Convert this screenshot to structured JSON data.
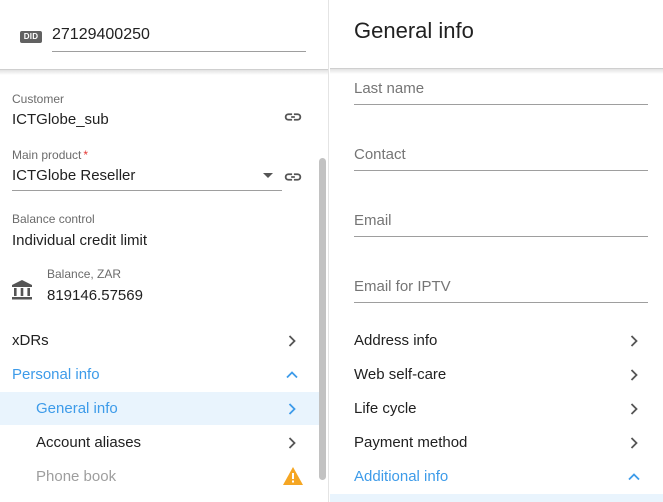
{
  "left": {
    "did": {
      "badge": "DID",
      "value": "27129400250"
    },
    "customer": {
      "label": "Customer",
      "value": "ICTGlobe_sub",
      "icon": "link-icon"
    },
    "main_product": {
      "label": "Main product",
      "required_mark": "*",
      "value": "ICTGlobe Reseller",
      "icon": "link-icon"
    },
    "balance_control": {
      "label": "Balance control",
      "value": "Individual credit limit"
    },
    "balance": {
      "label": "Balance, ZAR",
      "value": "819146.57569",
      "icon": "bank-icon"
    },
    "nav": {
      "xdrs": "xDRs",
      "personal_info": "Personal info",
      "general_info": "General info",
      "account_aliases": "Account aliases",
      "phone_book": "Phone book"
    },
    "colors": {
      "accent": "#3d9be9",
      "active_bg": "#e9f4fd",
      "warning": "#f5a623"
    }
  },
  "right": {
    "title": "General info",
    "fields": {
      "last_name": "Last name",
      "contact": "Contact",
      "email": "Email",
      "email_iptv": "Email for IPTV"
    },
    "sections": {
      "address_info": "Address info",
      "web_self_care": "Web self-care",
      "life_cycle": "Life cycle",
      "payment_method": "Payment method",
      "additional_info": "Additional info"
    }
  }
}
